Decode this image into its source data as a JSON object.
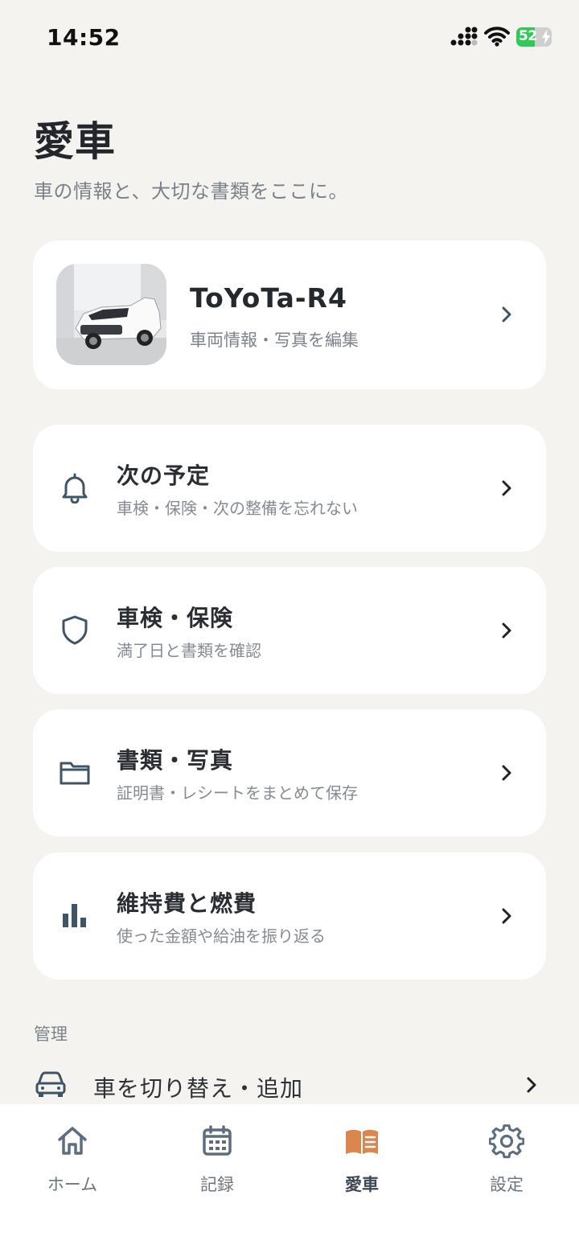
{
  "status_bar": {
    "time": "14:52",
    "battery_percent": 52,
    "battery_label": "52",
    "icons": [
      "signal-icon",
      "wifi-icon",
      "battery-charging-icon"
    ]
  },
  "header": {
    "title": "愛車",
    "subtitle": "車の情報と、大切な書類をここに。"
  },
  "vehicle": {
    "name": "ToYoTa-R4",
    "edit_label": "車両情報・写真を編集"
  },
  "menu": [
    {
      "icon": "bell-icon",
      "title": "次の予定",
      "subtitle": "車検・保険・次の整備を忘れない"
    },
    {
      "icon": "shield-icon",
      "title": "車検・保険",
      "subtitle": "満了日と書類を確認"
    },
    {
      "icon": "folder-icon",
      "title": "書類・写真",
      "subtitle": "証明書・レシートをまとめて保存"
    },
    {
      "icon": "bar-chart-icon",
      "title": "維持費と燃費",
      "subtitle": "使った金額や給油を振り返る"
    }
  ],
  "manage": {
    "section_label": "管理",
    "switch_label": "車を切り替え・追加"
  },
  "tabs": [
    {
      "icon": "home-icon",
      "label": "ホーム",
      "active": false
    },
    {
      "icon": "calendar-icon",
      "label": "記録",
      "active": false
    },
    {
      "icon": "book-icon",
      "label": "愛車",
      "active": true
    },
    {
      "icon": "gear-icon",
      "label": "設定",
      "active": false
    }
  ],
  "colors": {
    "background": "#f4f3f0",
    "card": "#ffffff",
    "icon": "#3f5566",
    "accent": "#d9874f",
    "battery": "#34c759"
  }
}
